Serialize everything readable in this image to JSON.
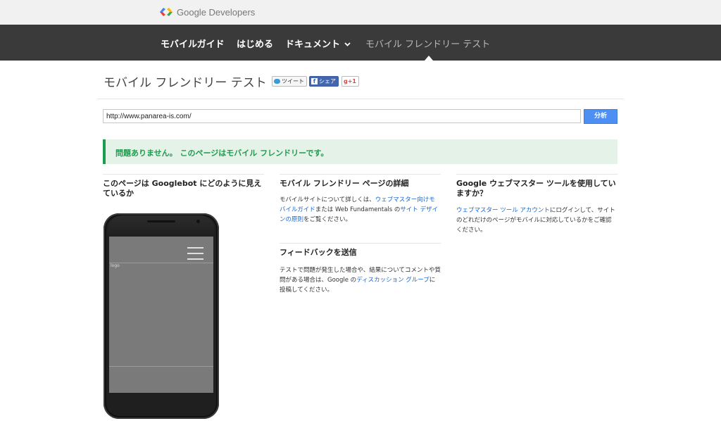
{
  "header": {
    "brand": "Google Developers"
  },
  "nav": {
    "items": [
      {
        "label": "モバイルガイド"
      },
      {
        "label": "はじめる"
      },
      {
        "label": "ドキュメント"
      },
      {
        "label": "モバイル フレンドリー テスト"
      }
    ]
  },
  "title": {
    "text": "モバイル フレンドリー テスト",
    "tweet": "ツイート",
    "share": "シェア",
    "plusone": "g+1"
  },
  "search": {
    "value": "http://www.panarea-is.com/",
    "button": "分析"
  },
  "result": {
    "message": "問題ありません。 このページはモバイル フレンドリーです。",
    "color": "#1e9c4e"
  },
  "columns": {
    "googlebot": {
      "heading": "このページは Googlebot にどのように見えているか",
      "screen_logo": "logo"
    },
    "details": {
      "heading": "モバイル フレンドリー ページの詳細",
      "t1": "モバイルサイトについて詳しくは、",
      "link1": "ウェブマスター向けモバイルガイド",
      "t2": "または Web Fundamentals の",
      "link2": "サイト デザインの原則",
      "t3": "をご覧ください。"
    },
    "feedback": {
      "heading": "フィードバックを送信",
      "t1": "テストで問題が発生した場合や、結果についてコメントや質問がある場合は、Google の",
      "link1": "ディスカッション グループ",
      "t2": "に投稿してください。"
    },
    "webmaster": {
      "heading": "Google ウェブマスター ツールを使用していますか？",
      "link1": "ウェブマスター ツール アカウント",
      "t1": "にログインして、サイトのどれだけのページがモバイルに対応しているかをご確認ください。"
    }
  }
}
